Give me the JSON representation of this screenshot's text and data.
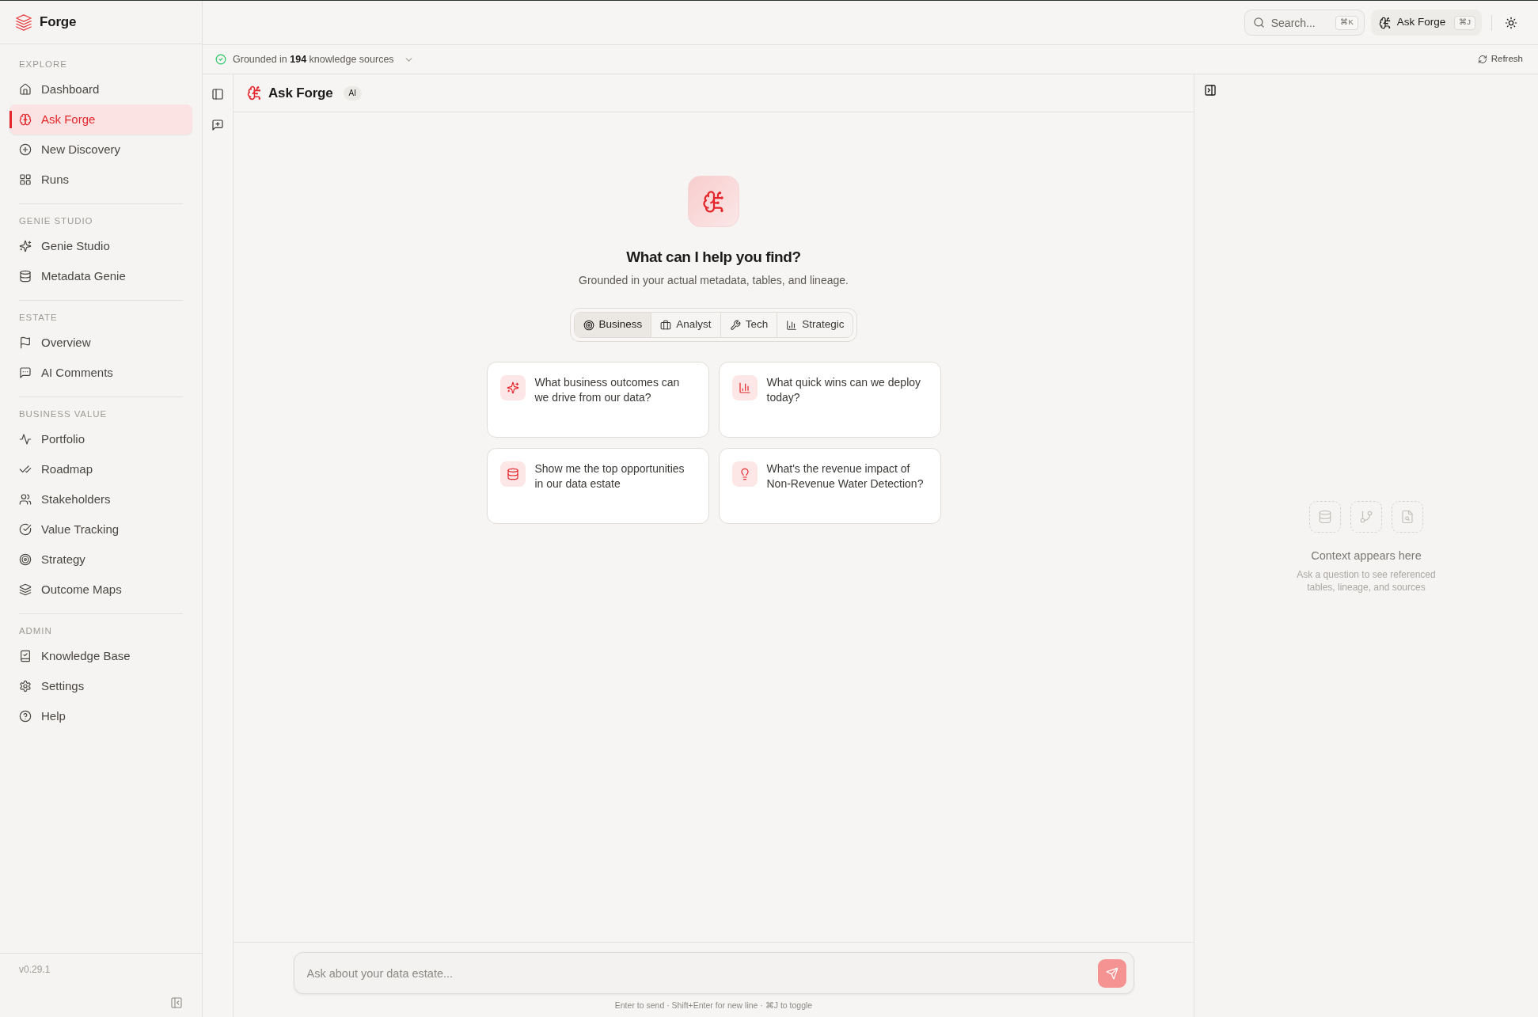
{
  "sidebar": {
    "brand": "Forge",
    "sections": [
      {
        "label": "EXPLORE",
        "items": [
          {
            "label": "Dashboard",
            "selected": false
          },
          {
            "label": "Ask Forge",
            "selected": true
          },
          {
            "label": "New Discovery",
            "selected": false
          },
          {
            "label": "Runs",
            "selected": false
          }
        ]
      },
      {
        "label": "GENIE STUDIO",
        "items": [
          {
            "label": "Genie Studio",
            "selected": false
          },
          {
            "label": "Metadata Genie",
            "selected": false
          }
        ]
      },
      {
        "label": "ESTATE",
        "items": [
          {
            "label": "Overview",
            "selected": false
          },
          {
            "label": "AI Comments",
            "selected": false
          }
        ]
      },
      {
        "label": "BUSINESS VALUE",
        "items": [
          {
            "label": "Portfolio",
            "selected": false
          },
          {
            "label": "Roadmap",
            "selected": false
          },
          {
            "label": "Stakeholders",
            "selected": false
          },
          {
            "label": "Value Tracking",
            "selected": false
          },
          {
            "label": "Strategy",
            "selected": false
          },
          {
            "label": "Outcome Maps",
            "selected": false
          }
        ]
      },
      {
        "label": "ADMIN",
        "items": [
          {
            "label": "Knowledge Base",
            "selected": false
          },
          {
            "label": "Settings",
            "selected": false
          },
          {
            "label": "Help",
            "selected": false
          }
        ]
      }
    ],
    "version": "v0.29.1"
  },
  "top_bar": {
    "search": {
      "placeholder": "Search...",
      "shortcut": "⌘K"
    },
    "ask_button": {
      "label": "Ask Forge",
      "shortcut": "⌘J"
    }
  },
  "status_bar": {
    "text": "Grounded in **194** knowledge sources",
    "refresh": "Refresh"
  },
  "chat": {
    "title": "Ask Forge",
    "badge": "AI",
    "heading": "What can I help you find?",
    "subheading": "Grounded in your actual metadata, tables, and lineage.",
    "modes": [
      {
        "label": "Business",
        "selected": true
      },
      {
        "label": "Analyst",
        "selected": false
      },
      {
        "label": "Tech",
        "selected": false
      },
      {
        "label": "Strategic",
        "selected": false
      }
    ],
    "suggestions": [
      {
        "text": "What business outcomes can we drive from our data?"
      },
      {
        "text": "What quick wins can we deploy today?"
      },
      {
        "text": "Show me the top opportunities in our data estate"
      },
      {
        "text": "What's the revenue impact of Non-Revenue Water Detection?"
      }
    ],
    "input": {
      "placeholder": "Ask about your data estate..."
    },
    "send_button": {
      "disabled": true
    },
    "hint": "Enter to send · Shift+Enter for new line · ⌘J to toggle"
  },
  "context_panel": {
    "title": "Context appears here",
    "subtitle": "Ask a question to see referenced tables, lineage, and sources"
  }
}
